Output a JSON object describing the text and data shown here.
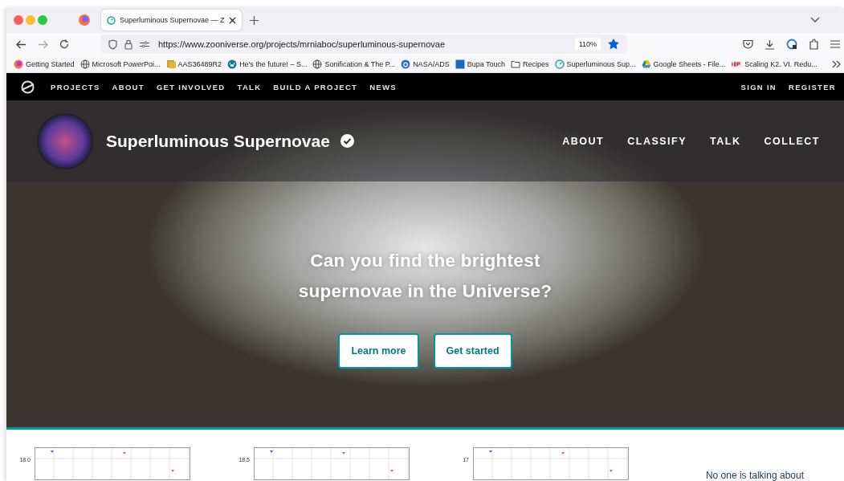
{
  "browser": {
    "tabs": [
      {
        "title": "Superluminous Supernovae — Z",
        "selected": true
      }
    ],
    "url": "https://www.zooniverse.org/projects/mrniaboc/superluminous-supernovae",
    "zoom": "110%",
    "bookmarked": true,
    "bookmarks": [
      {
        "kind": "firefox",
        "label": "Getting Started"
      },
      {
        "kind": "globe",
        "label": "Microsoft PowerPoi..."
      },
      {
        "kind": "stack",
        "label": "AAS36489R2"
      },
      {
        "kind": "wordpress",
        "label": "He's the future! – S..."
      },
      {
        "kind": "globe",
        "label": "Sonification & The P..."
      },
      {
        "kind": "ads",
        "label": "NASA/ADS"
      },
      {
        "kind": "square",
        "label": "Bupa Touch"
      },
      {
        "kind": "folder",
        "label": "Recipes"
      },
      {
        "kind": "zooniverse",
        "label": "Superluminous Sup..."
      },
      {
        "kind": "drive",
        "label": "Google Sheets - File..."
      },
      {
        "kind": "iop",
        "label": "Scaling K2. VI. Redu..."
      }
    ]
  },
  "site_nav": {
    "items": [
      "PROJECTS",
      "ABOUT",
      "GET INVOLVED",
      "TALK",
      "BUILD A PROJECT",
      "NEWS"
    ],
    "account": [
      "SIGN IN",
      "REGISTER"
    ]
  },
  "project": {
    "title": "Superluminous Supernovae",
    "verified": true,
    "nav": [
      {
        "label": "ABOUT",
        "selected": false
      },
      {
        "label": "CLASSIFY",
        "selected": false
      },
      {
        "label": "TALK",
        "selected": false
      },
      {
        "label": "COLLECT",
        "selected": false
      }
    ]
  },
  "hero": {
    "headline": [
      "Can you find the brightest",
      "supernovae in the Universe?"
    ],
    "buttons": [
      "Learn more",
      "Get started"
    ]
  },
  "subjects": [
    {
      "tick_label": "18.0"
    },
    {
      "tick_label": "18.5"
    },
    {
      "tick_label": "17"
    }
  ],
  "talk": {
    "message": "No one is talking about"
  }
}
